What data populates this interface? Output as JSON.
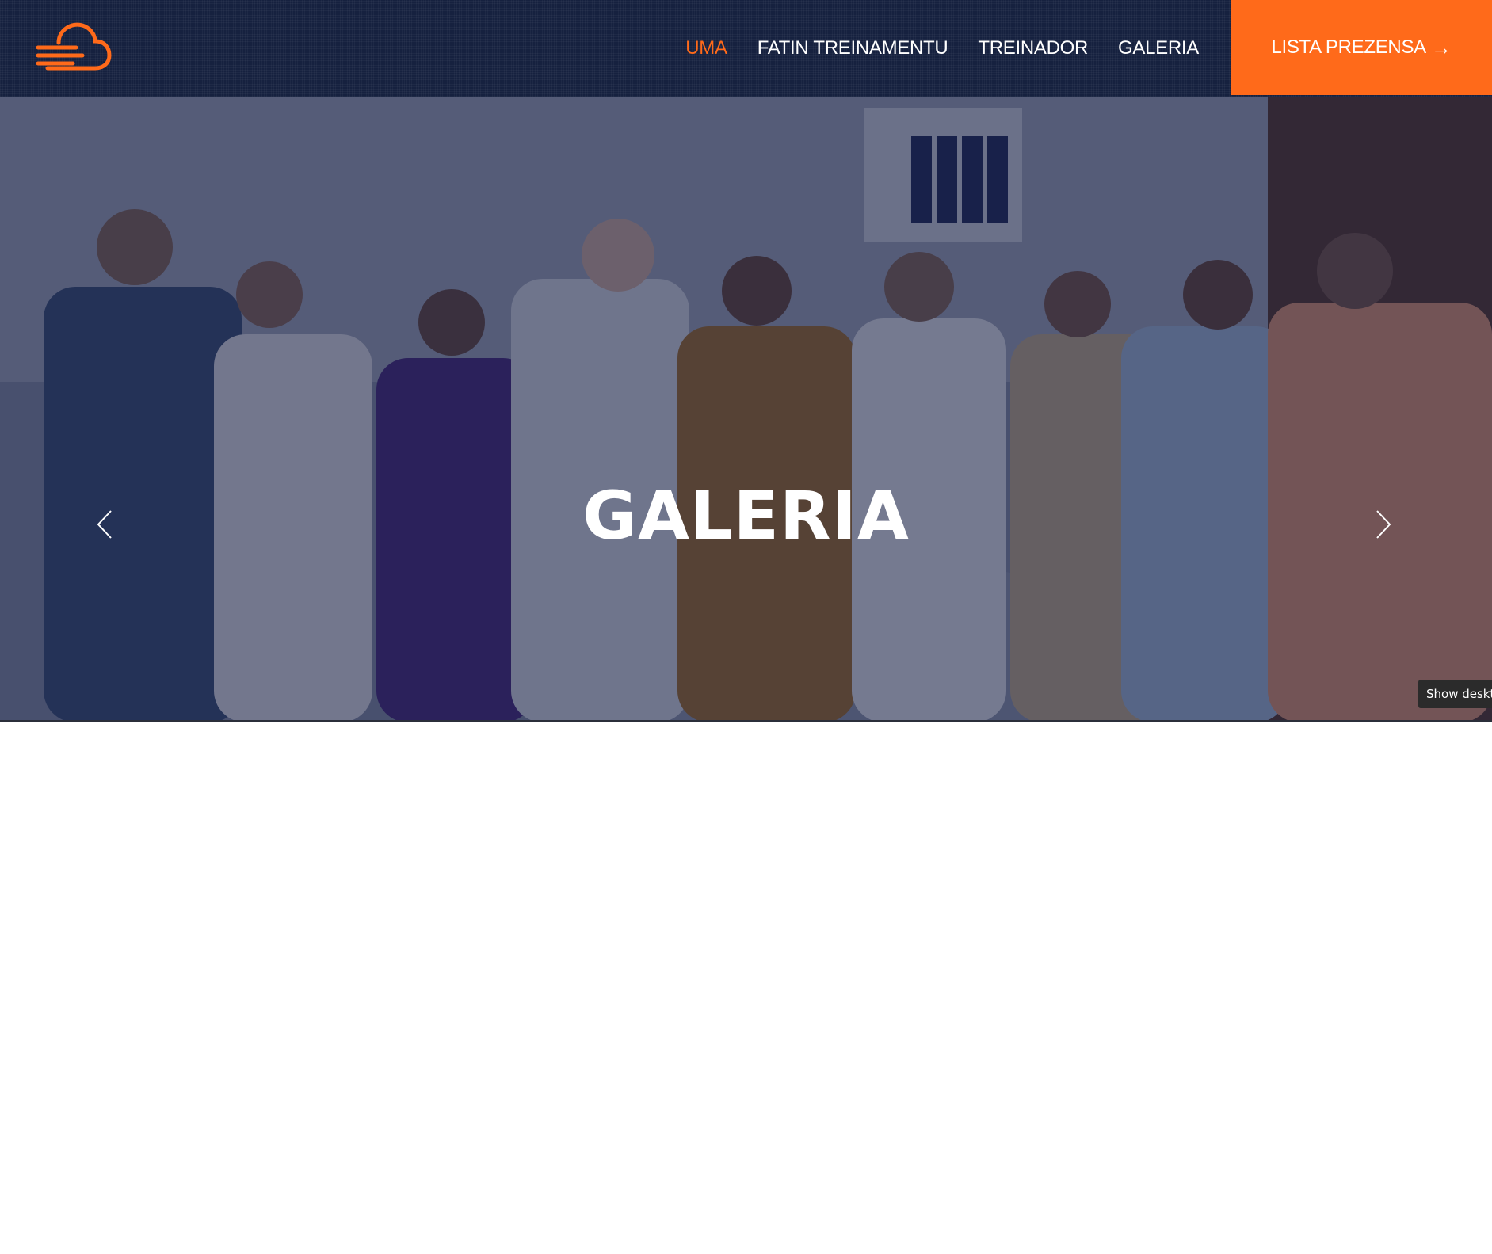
{
  "header": {
    "logo_icon": "cloud-wind-icon",
    "nav": [
      {
        "label": "UMA",
        "active": true
      },
      {
        "label": "FATIN TREINAMENTU",
        "active": false
      },
      {
        "label": "TREINADOR",
        "active": false
      },
      {
        "label": "GALERIA",
        "active": false
      }
    ],
    "cta_label": "LISTA PREZENSA",
    "cta_icon": "arrow-right-icon"
  },
  "hero": {
    "title": "GALERIA",
    "prev_icon": "chevron-left-icon",
    "next_icon": "chevron-right-icon"
  },
  "tooltip": {
    "text": "Show deskto"
  },
  "colors": {
    "nav_bg": "#16213f",
    "accent": "#ff6a1a",
    "text_light": "#ffffff"
  }
}
